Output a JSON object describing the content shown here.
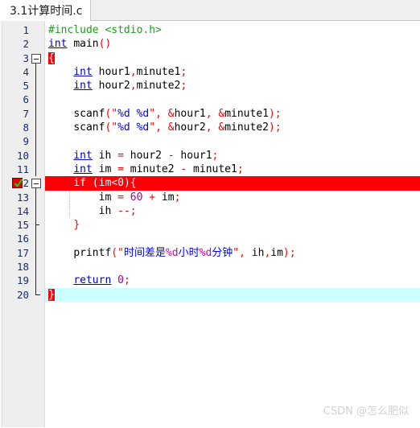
{
  "window": {
    "title": "3.1计算时间.c"
  },
  "tabs": [
    {
      "label": "3.1计算时间.c",
      "active": true
    }
  ],
  "editor": {
    "language": "c",
    "breakpoint_line": 12,
    "current_line": 20,
    "colors": {
      "keyword": "#0000c0",
      "preprocessor": "#1a9f1a",
      "operator": "#ff0000",
      "string": "#0000ff",
      "number": "#a000a0",
      "format_spec": "#cc00aa",
      "line_number": "#1c2f6b",
      "gutter_bg": "#eeeeee",
      "breakpoint_row_bg": "#fb0007",
      "current_row_bg": "#ccffff"
    },
    "lines": [
      {
        "n": "1",
        "text": "#include <stdio.h>"
      },
      {
        "n": "2",
        "text": "int main()"
      },
      {
        "n": "3",
        "text": "{"
      },
      {
        "n": "4",
        "text": "    int hour1,minute1;"
      },
      {
        "n": "5",
        "text": "    int hour2,minute2;"
      },
      {
        "n": "6",
        "text": ""
      },
      {
        "n": "7",
        "text": "    scanf(\"%d %d\", &hour1, &minute1);"
      },
      {
        "n": "8",
        "text": "    scanf(\"%d %d\", &hour2, &minute2);"
      },
      {
        "n": "9",
        "text": ""
      },
      {
        "n": "10",
        "text": "    int ih = hour2 - hour1;"
      },
      {
        "n": "11",
        "text": "    int im = minute2 - minute1;"
      },
      {
        "n": "12",
        "text": "    if (im<0){"
      },
      {
        "n": "13",
        "text": "        im = 60 + im;"
      },
      {
        "n": "14",
        "text": "        ih --;"
      },
      {
        "n": "15",
        "text": "    }"
      },
      {
        "n": "16",
        "text": ""
      },
      {
        "n": "17",
        "text": "    printf(\"时间差是%d小时%d分钟\", ih,im);"
      },
      {
        "n": "18",
        "text": ""
      },
      {
        "n": "19",
        "text": "    return 0;"
      },
      {
        "n": "20",
        "text": "}"
      }
    ]
  },
  "icons": {
    "breakpoint": "breakpoint-check-icon",
    "fold_collapse": "fold-minus-icon"
  },
  "watermark": {
    "text": "CSDN @怎么肥似"
  }
}
